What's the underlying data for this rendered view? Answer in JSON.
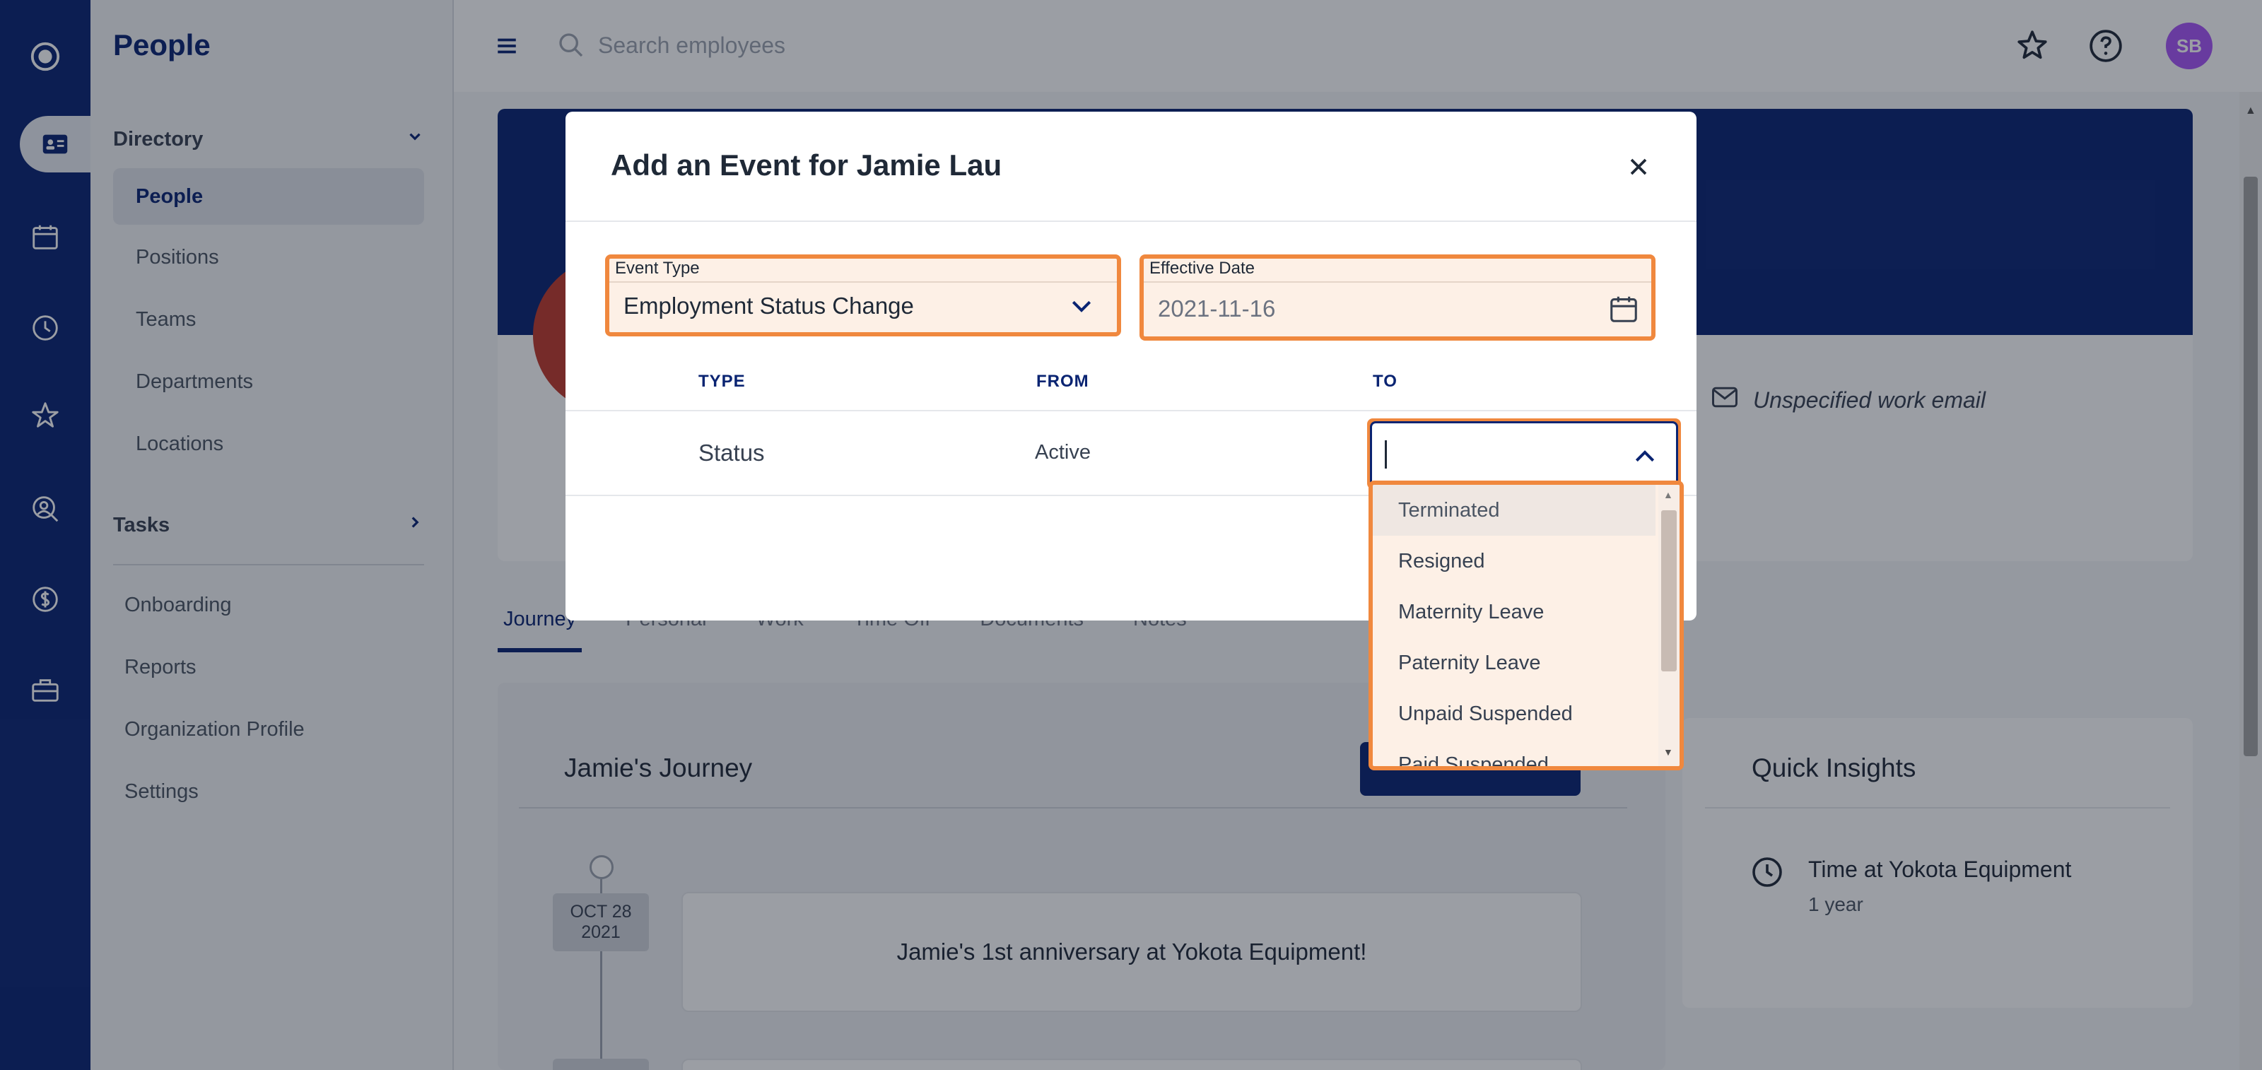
{
  "nav": {
    "title": "People",
    "directory_label": "Directory",
    "directory_items": [
      "People",
      "Positions",
      "Teams",
      "Departments",
      "Locations"
    ],
    "tasks_label": "Tasks",
    "links": [
      "Onboarding",
      "Reports",
      "Organization Profile",
      "Settings"
    ]
  },
  "topbar": {
    "search_placeholder": "Search employees",
    "avatar_initials": "SB"
  },
  "profile": {
    "email": "Unspecified work email"
  },
  "tabs": [
    "Journey",
    "Personal",
    "Work",
    "Time Off",
    "Documents",
    "Notes"
  ],
  "journey": {
    "title": "Jamie's Journey",
    "event_month_day": "OCT 28",
    "event_year": "2021",
    "event_text": "Jamie's 1st anniversary at Yokota Equipment!"
  },
  "insights": {
    "title": "Quick Insights",
    "label": "Time at Yokota Equipment",
    "value": "1 year"
  },
  "modal": {
    "title": "Add an Event for Jamie Lau",
    "event_type_label": "Event Type",
    "event_type_value": "Employment Status Change",
    "effective_date_label": "Effective Date",
    "effective_date_value": "2021-11-16",
    "columns": {
      "type": "TYPE",
      "from": "FROM",
      "to": "TO"
    },
    "row": {
      "type": "Status",
      "from": "Active",
      "to": ""
    },
    "to_options": [
      "Terminated",
      "Resigned",
      "Maternity Leave",
      "Paternity Leave",
      "Unpaid Suspended",
      "Paid Suspended"
    ]
  },
  "colors": {
    "brand": "#0a2472",
    "highlight": "#f0883e",
    "avatar": "#a855f7"
  },
  "icons": [
    "home-icon",
    "directory-icon",
    "calendar-icon",
    "clock-icon",
    "star-icon",
    "user-search-icon",
    "dollar-icon",
    "toolbox-icon",
    "menu-icon",
    "search-icon",
    "badge-star-icon",
    "help-icon",
    "close-icon",
    "chevron-down-icon",
    "chevron-up-icon",
    "mail-icon"
  ]
}
